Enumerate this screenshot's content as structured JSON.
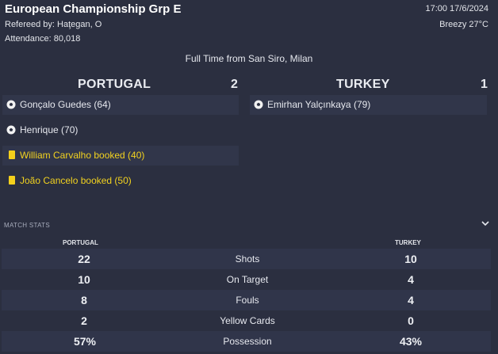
{
  "header": {
    "title": "European Championship Grp E",
    "referee": "Refereed by: Haţegan, O",
    "attendance": "Attendance: 80,018",
    "datetime": "17:00 17/6/2024",
    "weather": "Breezy 27°C"
  },
  "venue": "Full Time from San Siro, Milan",
  "home": {
    "name": "PORTUGAL",
    "score": "2",
    "events": [
      {
        "type": "goal-icon",
        "text": "Gonçalo Guedes (64)"
      },
      {
        "type": "goal-icon",
        "text": "Henrique (70)"
      },
      {
        "type": "yellow-card-icon",
        "text": "William Carvalho booked (40)"
      },
      {
        "type": "yellow-card-icon",
        "text": "João Cancelo booked (50)"
      }
    ]
  },
  "away": {
    "name": "TURKEY",
    "score": "1",
    "events": [
      {
        "type": "goal-icon",
        "text": "Emirhan Yalçınkaya (79)"
      }
    ]
  },
  "match_stats": {
    "label": "MATCH STATS",
    "home_header": "PORTUGAL",
    "away_header": "TURKEY",
    "rows": [
      {
        "home": "22",
        "label": "Shots",
        "away": "10"
      },
      {
        "home": "10",
        "label": "On Target",
        "away": "4"
      },
      {
        "home": "8",
        "label": "Fouls",
        "away": "4"
      },
      {
        "home": "2",
        "label": "Yellow Cards",
        "away": "0"
      },
      {
        "home": "57%",
        "label": "Possession",
        "away": "43%"
      }
    ]
  },
  "colors": {
    "background": "#2b2f40",
    "booked_text": "#f2d21f",
    "yellow_card": "#f4d01c"
  }
}
